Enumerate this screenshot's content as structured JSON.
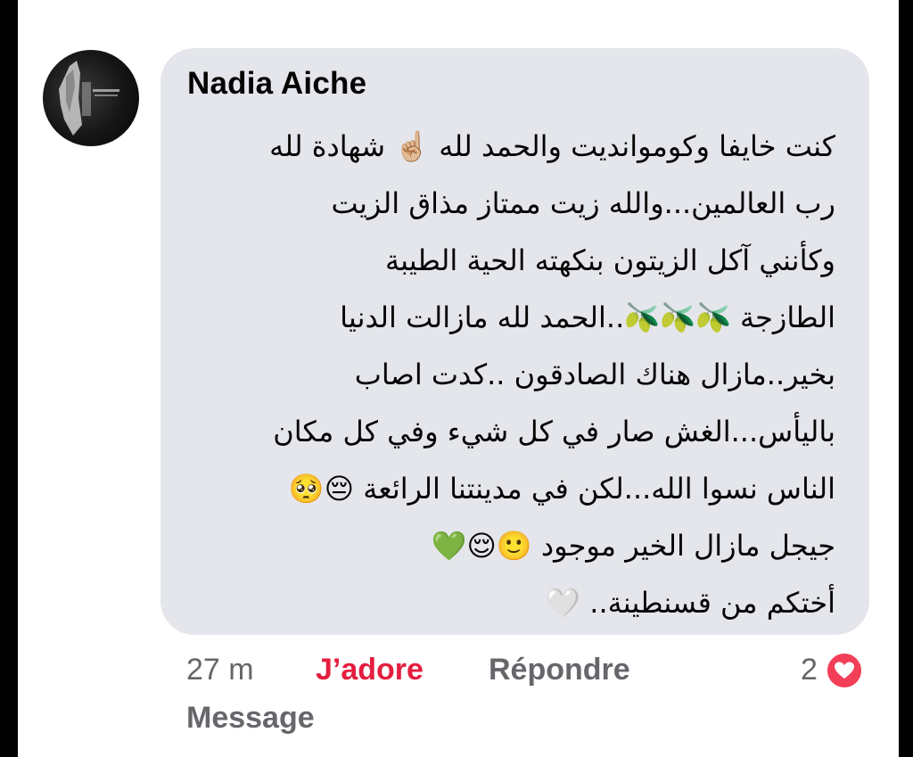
{
  "comment": {
    "author": "Nadia Aiche",
    "lines": [
      "كنت خايفا وكوموانديت والحمد لله ☝🏼 شهادة لله",
      "رب العالمين...والله زيت ممتاز مذاق الزيت",
      "وكأنني آكل الزيتون بنكهته الحية الطيبة",
      "الطازجة 🫒🫒🫒..الحمد لله مازالت الدنيا",
      "بخير..مازال هناك الصادقون ..كدت اصاب",
      "باليأس...الغش صار في كل شيء وفي كل مكان",
      "الناس نسوا الله...لكن في مدينتنا الرائعة 😔🥺",
      "جيجل مازال الخير موجود 🙂😌💚",
      "أختكم من قسنطينة.. 🤍"
    ]
  },
  "footer": {
    "time": "27 m",
    "like_label": "J’adore",
    "reply_label": "Répondre",
    "reaction_count": "2",
    "message_label": "Message"
  },
  "icons": {
    "avatar": "profile-photo",
    "reaction": "love-heart-icon"
  },
  "colors": {
    "bubble": "#e4e6eb",
    "like_active": "#e41e3f",
    "meta_text": "#65676b",
    "reaction_heart": "#f33e58"
  }
}
